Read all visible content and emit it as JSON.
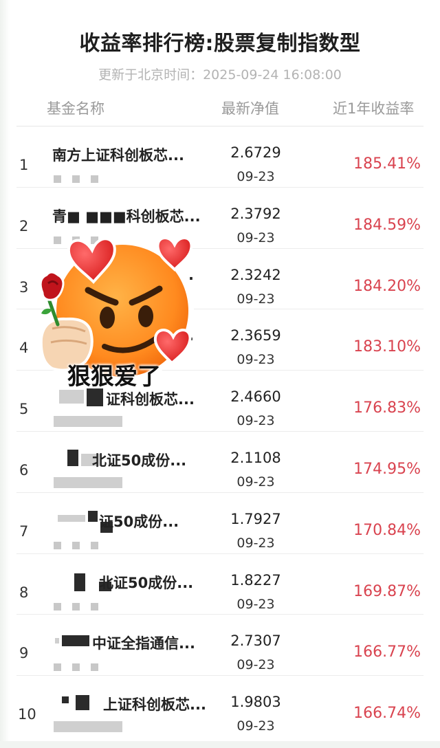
{
  "page": {
    "title": "收益率排行榜:股票复制指数型",
    "update_time": "更新于北京时间：2025-09-24 16:08:00"
  },
  "table": {
    "headers": {
      "name": "基金名称",
      "nav": "最新净值",
      "return": "近1年收益率"
    },
    "rows": [
      {
        "rank": "1",
        "name": "南方上证科创板芯...",
        "nav": "2.6729",
        "date": "09-23",
        "return": "185.41%"
      },
      {
        "rank": "2",
        "name": "青■  ■■■科创板芯...",
        "nav": "2.3792",
        "date": "09-23",
        "return": "184.59%"
      },
      {
        "rank": "3",
        "name": ".",
        "nav": "2.3242",
        "date": "09-23",
        "return": "184.20%"
      },
      {
        "rank": "4",
        "name": ".",
        "nav": "2.3659",
        "date": "09-23",
        "return": "183.10%"
      },
      {
        "rank": "5",
        "name": "证科创板芯...",
        "nav": "2.4660",
        "date": "09-23",
        "return": "176.83%"
      },
      {
        "rank": "6",
        "name": "北证50成份...",
        "nav": "2.1108",
        "date": "09-23",
        "return": "174.95%"
      },
      {
        "rank": "7",
        "name": "证50成份...",
        "nav": "1.7927",
        "date": "09-23",
        "return": "170.84%"
      },
      {
        "rank": "8",
        "name": "北证50成份...",
        "nav": "1.8227",
        "date": "09-23",
        "return": "169.87%"
      },
      {
        "rank": "9",
        "name": "中证全指通信...",
        "nav": "2.7307",
        "date": "09-23",
        "return": "166.77%"
      },
      {
        "rank": "10",
        "name": "上证科创板芯...",
        "nav": "1.9803",
        "date": "09-23",
        "return": "166.74%"
      }
    ]
  },
  "sticker": {
    "caption": "狠狠爱了",
    "icon": "heart-eyes-smirk-emoji-with-rose"
  },
  "colors": {
    "return_red": "#d9434f",
    "muted_gray": "#9a9a9a"
  }
}
